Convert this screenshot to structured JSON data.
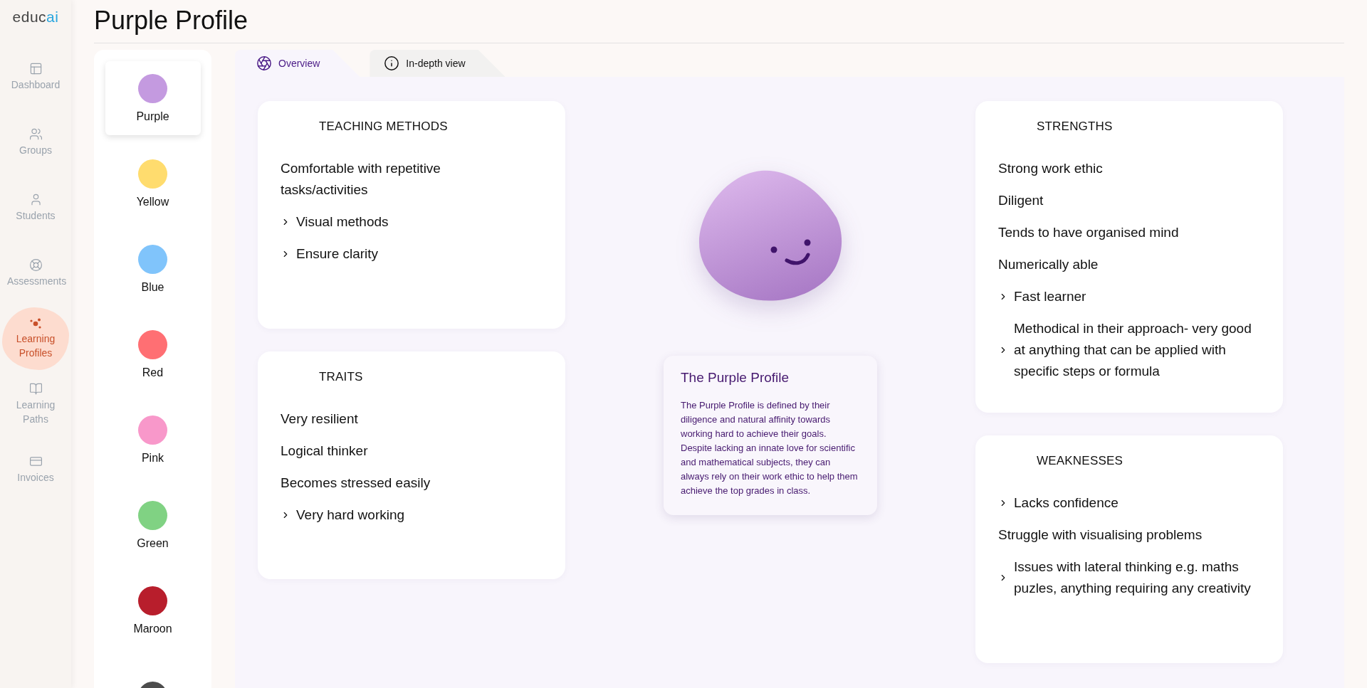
{
  "logo": {
    "main": "educ",
    "accent": "ai"
  },
  "nav": [
    {
      "label": "Dashboard",
      "kind": "dashboard",
      "selected": false
    },
    {
      "label": "Groups",
      "kind": "groups",
      "selected": false
    },
    {
      "label": "Students",
      "kind": "students",
      "selected": false
    },
    {
      "label": "Assessments",
      "kind": "assessments",
      "selected": false
    },
    {
      "label": "Learning Profiles",
      "kind": "profiles",
      "selected": true
    },
    {
      "label": "Learning Paths",
      "kind": "paths",
      "selected": false
    },
    {
      "label": "Invoices",
      "kind": "invoices",
      "selected": false
    }
  ],
  "title": "Purple Profile",
  "profiles": [
    {
      "label": "Purple",
      "color": "#c49ae0",
      "selected": true
    },
    {
      "label": "Yellow",
      "color": "#ffdc6e",
      "selected": false
    },
    {
      "label": "Blue",
      "color": "#80c4fb",
      "selected": false
    },
    {
      "label": "Red",
      "color": "#ff6f73",
      "selected": false
    },
    {
      "label": "Pink",
      "color": "#f898ca",
      "selected": false
    },
    {
      "label": "Green",
      "color": "#80d283",
      "selected": false
    },
    {
      "label": "Maroon",
      "color": "#b81e2c",
      "selected": false
    },
    {
      "color": "#4d4d4d",
      "selected": false
    }
  ],
  "tabs": [
    {
      "label": "Overview",
      "kind": "overview",
      "selected": true
    },
    {
      "label": "In-depth view",
      "kind": "details",
      "selected": false
    }
  ],
  "cards_left": [
    {
      "heading": "TEACHING METHODS",
      "items": [
        {
          "text": "Comfortable with repetitive tasks/activities",
          "expandable": false
        },
        {
          "text": "Visual methods",
          "expandable": true
        },
        {
          "text": "Ensure clarity",
          "expandable": true
        }
      ]
    },
    {
      "heading": "TRAITS",
      "items": [
        {
          "text": "Very resilient",
          "expandable": false
        },
        {
          "text": "Logical thinker",
          "expandable": false
        },
        {
          "text": "Becomes stressed easily",
          "expandable": false
        },
        {
          "text": "Very hard working",
          "expandable": true
        }
      ]
    }
  ],
  "description": {
    "title": "The Purple Profile",
    "text": "The Purple Profile is defined by their diligence and natural affinity towards working hard to achieve their goals. Despite lacking an innate love for scientific and mathematical subjects, they can always rely on their work ethic to help them achieve the top grades in class."
  },
  "cards_right": [
    {
      "heading": "STRENGTHS",
      "items": [
        {
          "text": "Strong work ethic",
          "expandable": false
        },
        {
          "text": "Diligent",
          "expandable": false
        },
        {
          "text": "Tends to have organised mind",
          "expandable": false
        },
        {
          "text": "Numerically able",
          "expandable": false
        },
        {
          "text": "Fast learner",
          "expandable": true
        },
        {
          "text": "Methodical in their approach- very good at anything that can be applied with specific steps or formula",
          "expandable": true
        }
      ]
    },
    {
      "heading": "WEAKNESSES",
      "items": [
        {
          "text": "Lacks confidence",
          "expandable": true
        },
        {
          "text": "Struggle with visualising problems",
          "expandable": false
        },
        {
          "text": "Issues with lateral thinking e.g. maths puzles, anything requiring any creativity",
          "expandable": true
        }
      ]
    }
  ]
}
